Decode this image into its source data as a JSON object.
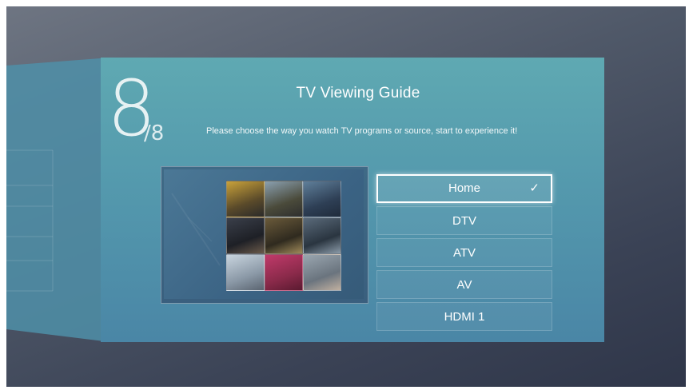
{
  "guide": {
    "step": "8",
    "total": "/8",
    "title": "TV Viewing Guide",
    "description": "Please choose the way you watch TV programs or source, start to experience it!"
  },
  "menu": {
    "items": [
      {
        "label": "Home",
        "selected": true
      },
      {
        "label": "DTV",
        "selected": false
      },
      {
        "label": "ATV",
        "selected": false
      },
      {
        "label": "AV",
        "selected": false
      },
      {
        "label": "HDMI 1",
        "selected": false
      }
    ],
    "selected_mark": "✓"
  },
  "colors": {
    "panel": "#5499ad",
    "background": "#3a4255",
    "text": "#ffffff"
  },
  "icons": {
    "selected": "checkmark-icon"
  }
}
